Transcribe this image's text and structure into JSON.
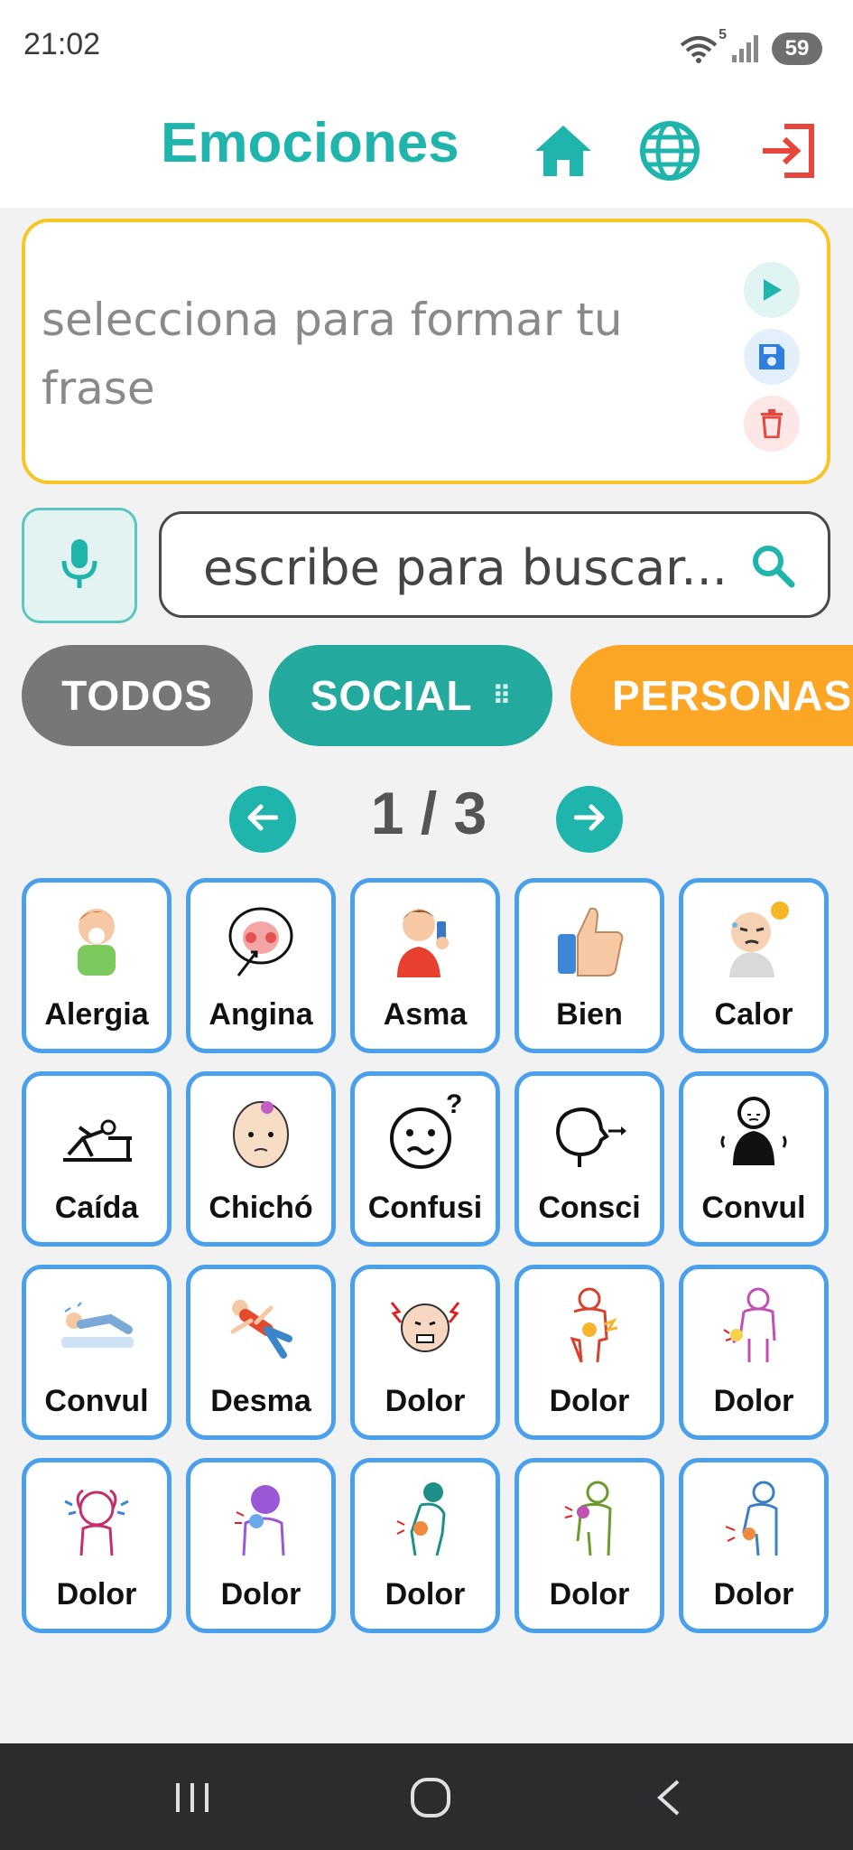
{
  "status_bar": {
    "time": "21:02",
    "wifi_badge": "5",
    "battery": "59",
    "icons": [
      "wifi-icon",
      "signal-icon",
      "battery-icon"
    ]
  },
  "header": {
    "title": "Emociones",
    "icons": [
      "home-icon",
      "globe-icon",
      "exit-icon"
    ],
    "colors": {
      "accent": "#1fb5ad",
      "exit": "#e8453c"
    }
  },
  "phrase": {
    "placeholder": "selecciona para formar tu frase",
    "actions": [
      "play-icon",
      "save-icon",
      "trash-icon"
    ],
    "border_color": "#f7c528"
  },
  "search": {
    "placeholder": "escribe para buscar...",
    "mic_icon": "microphone-icon",
    "search_icon": "search-icon"
  },
  "categories": [
    {
      "label": "TODOS",
      "color": "#777777"
    },
    {
      "label": "SOCIAL",
      "color": "#23a99d",
      "selected": true
    },
    {
      "label": "PERSONAS",
      "color": "#fca625"
    }
  ],
  "pagination": {
    "indicator": "1 / 3",
    "current": 1,
    "total": 3
  },
  "tiles": [
    {
      "label": "Alergia",
      "icon": "sneezing-child-icon"
    },
    {
      "label": "Angina",
      "icon": "open-mouth-throat-icon"
    },
    {
      "label": "Asma",
      "icon": "inhaler-icon"
    },
    {
      "label": "Bien",
      "icon": "thumbs-up-icon"
    },
    {
      "label": "Calor",
      "icon": "hot-sweating-icon"
    },
    {
      "label": "Caída",
      "icon": "falling-person-icon"
    },
    {
      "label": "Chichó",
      "icon": "head-bump-icon"
    },
    {
      "label": "Confusi",
      "icon": "confused-face-icon"
    },
    {
      "label": "Consci",
      "icon": "conscious-head-icon"
    },
    {
      "label": "Convul",
      "icon": "convulsion-person-icon"
    },
    {
      "label": "Convul",
      "icon": "convulsion-bed-icon"
    },
    {
      "label": "Desma",
      "icon": "fainting-icon"
    },
    {
      "label": "Dolor",
      "icon": "pain-face-icon"
    },
    {
      "label": "Dolor",
      "icon": "stomach-pain-icon"
    },
    {
      "label": "Dolor",
      "icon": "arm-pain-icon"
    },
    {
      "label": "Dolor",
      "icon": "headache-icon"
    },
    {
      "label": "Dolor",
      "icon": "throat-pain-icon"
    },
    {
      "label": "Dolor",
      "icon": "back-pain-icon"
    },
    {
      "label": "Dolor",
      "icon": "shoulder-pain-icon"
    },
    {
      "label": "Dolor",
      "icon": "hand-pain-icon"
    }
  ],
  "navbar": {
    "icons": [
      "recent-apps-icon",
      "home-circle-icon",
      "back-icon"
    ]
  }
}
